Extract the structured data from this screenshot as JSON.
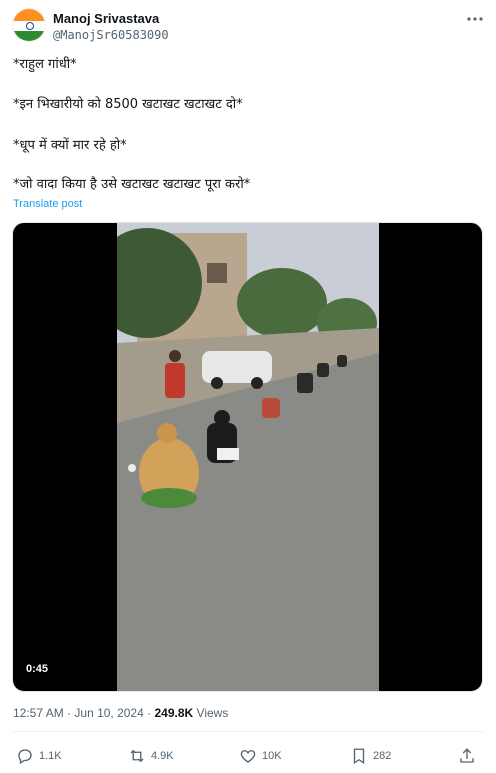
{
  "author": {
    "name": "Manoj Srivastava",
    "handle": "@ManojSr60583090",
    "avatar_icon": "india-flag-avatar"
  },
  "post": {
    "lines": [
      "*राहुल गांधी*",
      "*इन भिखारीयो को 8500  खटाखट खटाखट दो*",
      "*धूप में क्यों मार रहे हो*",
      "*जो वादा किया है उसे खटाखट खटाखट पूरा करो*"
    ],
    "translate_label": "Translate post"
  },
  "media": {
    "duration": "0:45"
  },
  "meta": {
    "time": "12:57 AM",
    "separator1": "·",
    "date": "Jun 10, 2024",
    "separator2": "·",
    "views_count": "249.8K",
    "views_label": "Views"
  },
  "actions": {
    "reply_count": "1.1K",
    "repost_count": "4.9K",
    "like_count": "10K",
    "bookmark_count": "282"
  },
  "colors": {
    "link": "#1d9bf0",
    "secondary_text": "#536471",
    "primary_text": "#0f1419"
  }
}
